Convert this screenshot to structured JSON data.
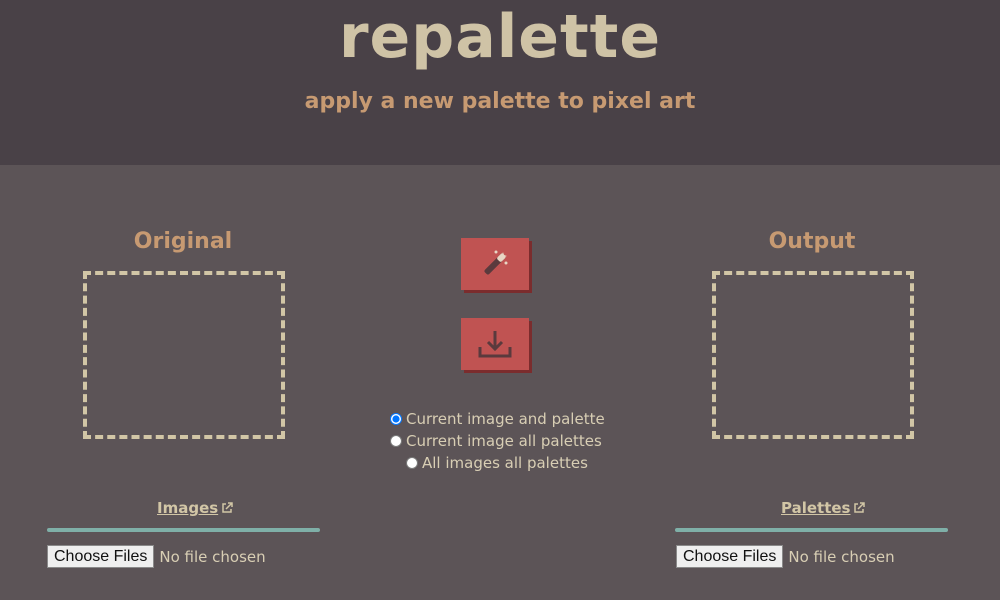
{
  "header": {
    "title": "repalette",
    "subtitle": "apply a new palette to pixel art"
  },
  "original": {
    "title": "Original"
  },
  "output": {
    "title": "Output"
  },
  "actions": {
    "apply_icon": "magic-wand-icon",
    "download_icon": "download-icon"
  },
  "options": [
    {
      "label": "Current image and palette",
      "checked": true
    },
    {
      "label": "Current image all palettes",
      "checked": false
    },
    {
      "label": "All images all palettes",
      "checked": false
    }
  ],
  "images_section": {
    "link_label": "Images",
    "button_label": "Choose Files",
    "status": "No file chosen"
  },
  "palettes_section": {
    "link_label": "Palettes",
    "button_label": "Choose Files",
    "status": "No file chosen"
  },
  "colors": {
    "accent_button": "#c05352",
    "title": "#cfc3a6",
    "subtitle": "#c79a72",
    "divider": "#7fb0a8"
  }
}
